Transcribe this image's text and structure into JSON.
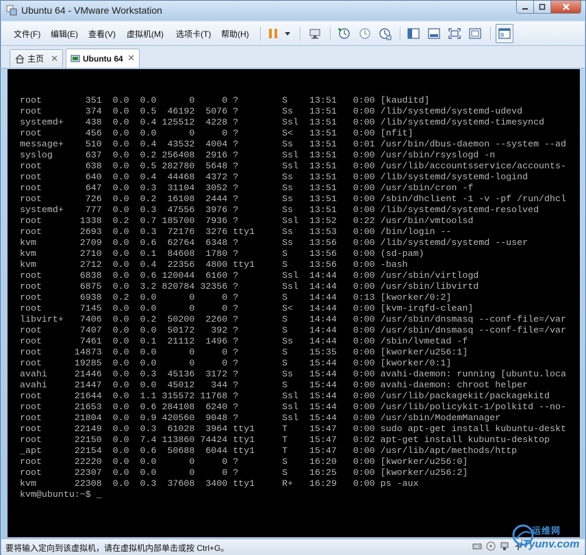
{
  "window": {
    "title": "Ubuntu 64 - VMware Workstation",
    "minimize_glyph": "▁",
    "maximize_glyph": "□",
    "close_glyph": "✕"
  },
  "menu": {
    "items": [
      "文件(F)",
      "编辑(E)",
      "查看(V)",
      "虚拟机(M)",
      "选项卡(T)",
      "帮助(H)"
    ]
  },
  "toolbar": {
    "icons": [
      "pause-icon",
      "dropdown-arrow-icon",
      "send-ctrl-alt-del-icon",
      "snapshot-take-icon",
      "snapshot-revert-icon",
      "snapshot-manager-icon",
      "sidebar-toggle-icon",
      "console-view-icon",
      "fullscreen-icon",
      "unity-icon",
      "thumbnail-bar-icon"
    ]
  },
  "tabs": [
    {
      "label": "主页",
      "close": "✕"
    },
    {
      "label": "Ubuntu 64",
      "close": "✕"
    }
  ],
  "terminal": {
    "lines": [
      "root        351  0.0  0.0      0     0 ?        S    13:51   0:00 [kauditd]",
      "root        374  0.0  0.5  46192  5076 ?        Ss   13:51   0:00 /lib/systemd/systemd-udevd",
      "systemd+    438  0.0  0.4 125512  4228 ?        Ssl  13:51   0:00 /lib/systemd/systemd-timesyncd",
      "root        456  0.0  0.0      0     0 ?        S<   13:51   0:00 [nfit]",
      "message+    510  0.0  0.4  43532  4004 ?        Ss   13:51   0:01 /usr/bin/dbus-daemon --system --ad",
      "syslog      637  0.0  0.2 256408  2916 ?        Ssl  13:51   0:00 /usr/sbin/rsyslogd -n",
      "root        638  0.0  0.5 282780  5648 ?        Ssl  13:51   0:00 /usr/lib/accountsservice/accounts-",
      "root        640  0.0  0.4  44468  4372 ?        Ss   13:51   0:00 /lib/systemd/systemd-logind",
      "root        647  0.0  0.3  31104  3052 ?        Ss   13:51   0:00 /usr/sbin/cron -f",
      "root        726  0.0  0.2  16108  2444 ?        Ss   13:51   0:00 /sbin/dhclient -1 -v -pf /run/dhcl",
      "systemd+    777  0.0  0.3  47556  3976 ?        Ss   13:51   0:00 /lib/systemd/systemd-resolved",
      "root       1338  0.2  0.7 185700  7936 ?        Ssl  13:52   0:22 /usr/bin/vmtoolsd",
      "root       2693  0.0  0.3  72176  3276 tty1     Ss   13:53   0:00 /bin/login --",
      "kvm        2709  0.0  0.6  62764  6348 ?        Ss   13:56   0:00 /lib/systemd/systemd --user",
      "kvm        2710  0.0  0.1  84608  1780 ?        S    13:56   0:00 (sd-pam)",
      "kvm        2712  0.0  0.4  22356  4800 tty1     S    13:56   0:00 -bash",
      "root       6838  0.0  0.6 120044  6160 ?        Ssl  14:44   0:00 /usr/sbin/virtlogd",
      "root       6875  0.0  3.2 820784 32356 ?        Ssl  14:44   0:00 /usr/sbin/libvirtd",
      "root       6938  0.2  0.0      0     0 ?        S    14:44   0:13 [kworker/0:2]",
      "root       7145  0.0  0.0      0     0 ?        S<   14:44   0:00 [kvm-irqfd-clean]",
      "libvirt+   7406  0.0  0.2  50200  2260 ?        S    14:44   0:00 /usr/sbin/dnsmasq --conf-file=/var",
      "root       7407  0.0  0.0  50172   392 ?        S    14:44   0:00 /usr/sbin/dnsmasq --conf-file=/var",
      "root       7461  0.0  0.1  21112  1496 ?        Ss   14:44   0:00 /sbin/lvmetad -f",
      "root      14873  0.0  0.0      0     0 ?        S    15:35   0:00 [kworker/u256:1]",
      "root      19285  0.0  0.0      0     0 ?        S    15:44   0:00 [kworker/0:1]",
      "avahi     21446  0.0  0.3  45136  3172 ?        Ss   15:44   0:00 avahi-daemon: running [ubuntu.loca",
      "avahi     21447  0.0  0.0  45012   344 ?        S    15:44   0:00 avahi-daemon: chroot helper",
      "root      21644  0.0  1.1 315572 11768 ?        Ssl  15:44   0:00 /usr/lib/packagekit/packagekitd",
      "root      21653  0.0  0.6 284108  6240 ?        Ssl  15:44   0:00 /usr/lib/policykit-1/polkitd --no-",
      "root      21804  0.0  0.9 420560  9048 ?        Ssl  15:44   0:00 /usr/sbin/ModemManager",
      "root      22149  0.0  0.3  61028  3964 tty1     T    15:47   0:00 sudo apt-get install kubuntu-deskt",
      "root      22150  0.0  7.4 113860 74424 tty1     T    15:47   0:02 apt-get install kubuntu-desktop",
      "_apt      22154  0.0  0.6  50688  6044 tty1     T    15:47   0:00 /usr/lib/apt/methods/http",
      "root      22220  0.0  0.0      0     0 ?        S    16:20   0:00 [kworker/u256:0]",
      "root      22307  0.0  0.0      0     0 ?        S    16:25   0:00 [kworker/u256:2]",
      "kvm       22308  0.0  0.3  37608  3400 tty1     R+   16:29   0:00 ps -aux",
      "kvm@ubuntu:~$ _"
    ]
  },
  "status": {
    "text": "要将输入定向到该虚拟机，请在虚拟机内部单击或按 Ctrl+G。"
  },
  "watermark": {
    "line1": "运维网",
    "line2": "iTyunv.com"
  }
}
